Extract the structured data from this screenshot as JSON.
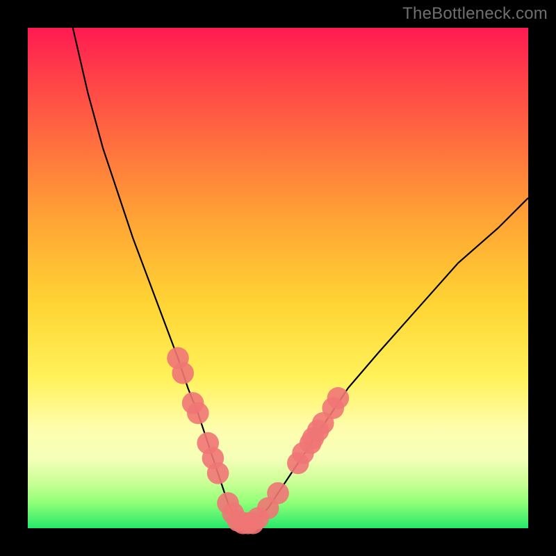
{
  "watermark": "TheBottleneck.com",
  "chart_data": {
    "type": "line",
    "title": "",
    "xlabel": "",
    "ylabel": "",
    "xlim": [
      0,
      100
    ],
    "ylim": [
      0,
      100
    ],
    "grid": false,
    "legend": false,
    "series": [
      {
        "name": "bottleneck-curve",
        "color": "#000000",
        "x": [
          9,
          12,
          15,
          18,
          21,
          24,
          27,
          30,
          32,
          34,
          36,
          38,
          39,
          40,
          41,
          42,
          43,
          44,
          45,
          46,
          48,
          50,
          52,
          54,
          56,
          58,
          60,
          64,
          70,
          78,
          86,
          94,
          100
        ],
        "y": [
          100,
          87,
          76,
          67,
          58,
          50,
          42,
          34,
          28,
          23,
          17,
          11,
          8,
          5,
          3,
          1,
          1,
          1,
          1,
          2,
          4,
          7,
          10,
          13,
          16,
          19,
          22,
          28,
          35,
          44,
          53,
          60,
          66
        ]
      }
    ],
    "markers": {
      "name": "highlight-dots",
      "color": "#ef7575",
      "radius": 2.2,
      "points_xy": [
        [
          30,
          34
        ],
        [
          31,
          31
        ],
        [
          33,
          25
        ],
        [
          34,
          23
        ],
        [
          36,
          17
        ],
        [
          37,
          14
        ],
        [
          38,
          11
        ],
        [
          40,
          5
        ],
        [
          41,
          3
        ],
        [
          42,
          1.5
        ],
        [
          43,
          1
        ],
        [
          44,
          1
        ],
        [
          45,
          1
        ],
        [
          46,
          2
        ],
        [
          48,
          4
        ],
        [
          50,
          7
        ],
        [
          54,
          13
        ],
        [
          55,
          15
        ],
        [
          56.5,
          17
        ],
        [
          57,
          18
        ],
        [
          58,
          19.5
        ],
        [
          59,
          21
        ],
        [
          61,
          24
        ],
        [
          62,
          26
        ]
      ]
    },
    "gradient_stops": [
      {
        "pos": 0.0,
        "color": "#ff1a52"
      },
      {
        "pos": 0.08,
        "color": "#ff3a4a"
      },
      {
        "pos": 0.22,
        "color": "#ff6b3f"
      },
      {
        "pos": 0.38,
        "color": "#ffa335"
      },
      {
        "pos": 0.55,
        "color": "#ffd433"
      },
      {
        "pos": 0.7,
        "color": "#fff25a"
      },
      {
        "pos": 0.8,
        "color": "#fffdae"
      },
      {
        "pos": 0.86,
        "color": "#f5ffb8"
      },
      {
        "pos": 0.91,
        "color": "#c9ff94"
      },
      {
        "pos": 0.95,
        "color": "#8eff78"
      },
      {
        "pos": 1.0,
        "color": "#25e86a"
      }
    ]
  }
}
